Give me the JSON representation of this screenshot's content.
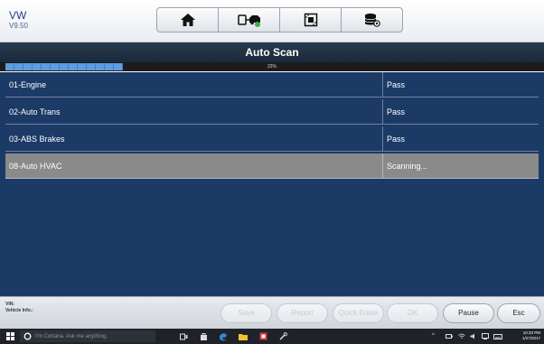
{
  "header": {
    "make": "VW",
    "version": "V9.50",
    "toolbar": [
      {
        "name": "home-icon"
      },
      {
        "name": "vehicle-swap-icon"
      },
      {
        "name": "screenshot-icon"
      },
      {
        "name": "data-settings-icon"
      }
    ]
  },
  "page": {
    "title": "Auto Scan",
    "progress_text": "22%",
    "progress_value": 22
  },
  "rows": [
    {
      "name": "01-Engine",
      "status": "Pass"
    },
    {
      "name": "02-Auto Trans",
      "status": "Pass"
    },
    {
      "name": "03-ABS Brakes",
      "status": "Pass"
    },
    {
      "name": "08-Auto HVAC",
      "status": "Scanning...",
      "active": true
    }
  ],
  "footer": {
    "vin_label": "VIN:",
    "vehicle_info_label": "Vehicle Info.:",
    "buttons": [
      {
        "label": "Save",
        "enabled": false
      },
      {
        "label": "Report",
        "enabled": false
      },
      {
        "label": "Quick Erase",
        "enabled": false
      },
      {
        "label": "OK",
        "enabled": false
      },
      {
        "label": "Pause",
        "enabled": true
      },
      {
        "label": "Esc",
        "enabled": true
      }
    ]
  },
  "taskbar": {
    "search_placeholder": "I'm Cortana. Ask me anything.",
    "time": "10:33 PM",
    "date": "1/27/2017"
  },
  "colors": {
    "list_bg": "#1c3a66",
    "active_row": "#8a8a8a",
    "title_band": "#1f3044",
    "progress": "#4a8fd9"
  }
}
